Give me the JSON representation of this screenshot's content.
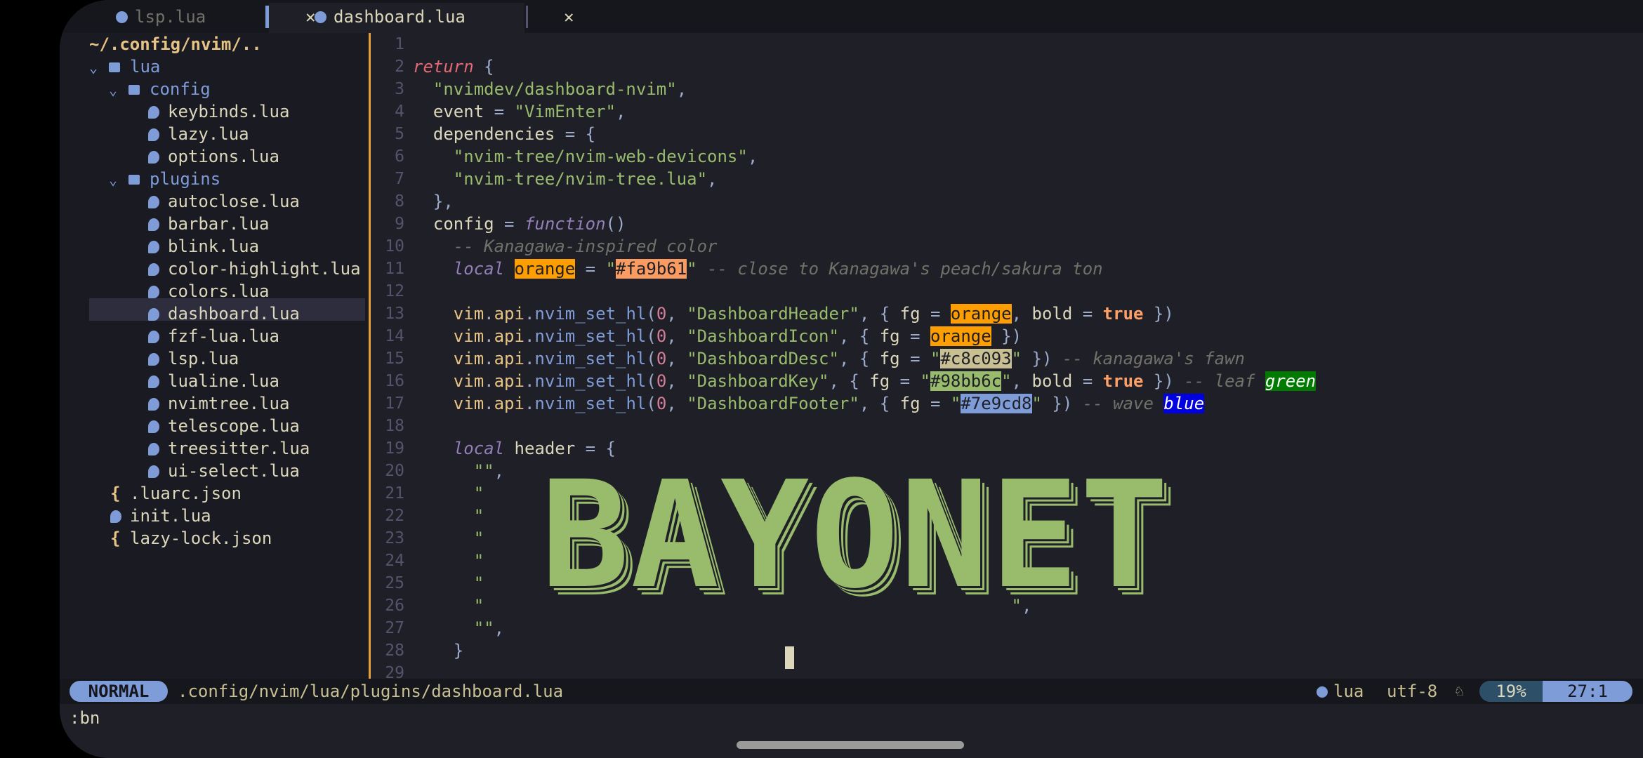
{
  "tabs": [
    {
      "label": "lsp.lua",
      "close": "✕"
    },
    {
      "label": "dashboard.lua",
      "close": "✕"
    }
  ],
  "tree": {
    "root": "~/.config/nvim/..",
    "items": [
      {
        "label": "lua",
        "type": "dir",
        "expanded": true,
        "depth": 0
      },
      {
        "label": "config",
        "type": "dir",
        "expanded": true,
        "depth": 1
      },
      {
        "label": "keybinds.lua",
        "type": "lua",
        "depth": 2
      },
      {
        "label": "lazy.lua",
        "type": "lua",
        "depth": 2
      },
      {
        "label": "options.lua",
        "type": "lua",
        "depth": 2
      },
      {
        "label": "plugins",
        "type": "dir",
        "expanded": true,
        "depth": 1
      },
      {
        "label": "autoclose.lua",
        "type": "lua",
        "depth": 2
      },
      {
        "label": "barbar.lua",
        "type": "lua",
        "depth": 2
      },
      {
        "label": "blink.lua",
        "type": "lua",
        "depth": 2
      },
      {
        "label": "color-highlight.lua",
        "type": "lua",
        "depth": 2
      },
      {
        "label": "colors.lua",
        "type": "lua",
        "depth": 2
      },
      {
        "label": "dashboard.lua",
        "type": "lua",
        "depth": 2,
        "selected": true
      },
      {
        "label": "fzf-lua.lua",
        "type": "lua",
        "depth": 2
      },
      {
        "label": "lsp.lua",
        "type": "lua",
        "depth": 2
      },
      {
        "label": "lualine.lua",
        "type": "lua",
        "depth": 2
      },
      {
        "label": "nvimtree.lua",
        "type": "lua",
        "depth": 2
      },
      {
        "label": "telescope.lua",
        "type": "lua",
        "depth": 2
      },
      {
        "label": "treesitter.lua",
        "type": "lua",
        "depth": 2
      },
      {
        "label": "ui-select.lua",
        "type": "lua",
        "depth": 2
      },
      {
        "label": ".luarc.json",
        "type": "json",
        "depth": 0
      },
      {
        "label": "init.lua",
        "type": "lua",
        "depth": 0
      },
      {
        "label": "lazy-lock.json",
        "type": "json",
        "depth": 0
      }
    ]
  },
  "editor": {
    "line_numbers": [
      "1",
      "2",
      "3",
      "4",
      "5",
      "6",
      "7",
      "8",
      "9",
      "10",
      "11",
      "12",
      "13",
      "14",
      "15",
      "16",
      "17",
      "18",
      "19",
      "20",
      "21",
      "22",
      "23",
      "24",
      "25",
      "26",
      "27",
      "28",
      "29"
    ],
    "lines": [
      [],
      [
        [
          "ret",
          "return"
        ],
        [
          "pu",
          " {"
        ]
      ],
      [
        [
          "str",
          "  \"nvimdev/dashboard-nvim\""
        ],
        [
          "pu",
          ","
        ]
      ],
      [
        [
          "fld",
          "  event "
        ],
        [
          "pu",
          "= "
        ],
        [
          "str",
          "\"VimEnter\""
        ],
        [
          "pu",
          ","
        ]
      ],
      [
        [
          "fld",
          "  dependencies "
        ],
        [
          "pu",
          "= {"
        ]
      ],
      [
        [
          "str",
          "    \"nvim-tree/nvim-web-devicons\""
        ],
        [
          "pu",
          ","
        ]
      ],
      [
        [
          "str",
          "    \"nvim-tree/nvim-tree.lua\""
        ],
        [
          "pu",
          ","
        ]
      ],
      [
        [
          "pu",
          "  },"
        ]
      ],
      [
        [
          "fld",
          "  config "
        ],
        [
          "pu",
          "= "
        ],
        [
          "kw",
          "function"
        ],
        [
          "pu",
          "()"
        ]
      ],
      [
        [
          "cm",
          "    -- Kanagawa-inspired color"
        ]
      ],
      [
        [
          "kw",
          "    local "
        ],
        [
          "hl-org",
          "orange"
        ],
        [
          "pu",
          " = "
        ],
        [
          "str",
          "\""
        ],
        [
          "hl-fa9",
          "#fa9b61"
        ],
        [
          "str",
          "\""
        ],
        [
          "cm",
          " -- close to Kanagawa's peach/sakura ton"
        ]
      ],
      [],
      [
        [
          "id",
          "    vim"
        ],
        [
          "pu",
          "."
        ],
        [
          "id",
          "api"
        ],
        [
          "pu",
          "."
        ],
        [
          "fn",
          "nvim_set_hl"
        ],
        [
          "pu",
          "("
        ],
        [
          "num",
          "0"
        ],
        [
          "pu",
          ", "
        ],
        [
          "str",
          "\"DashboardHeader\""
        ],
        [
          "pu",
          ", { "
        ],
        [
          "fld",
          "fg "
        ],
        [
          "pu",
          "= "
        ],
        [
          "hl-org",
          "orange"
        ],
        [
          "pu",
          ", "
        ],
        [
          "fld",
          "bold "
        ],
        [
          "pu",
          "= "
        ],
        [
          "bool",
          "true"
        ],
        [
          "pu",
          " })"
        ]
      ],
      [
        [
          "id",
          "    vim"
        ],
        [
          "pu",
          "."
        ],
        [
          "id",
          "api"
        ],
        [
          "pu",
          "."
        ],
        [
          "fn",
          "nvim_set_hl"
        ],
        [
          "pu",
          "("
        ],
        [
          "num",
          "0"
        ],
        [
          "pu",
          ", "
        ],
        [
          "str",
          "\"DashboardIcon\""
        ],
        [
          "pu",
          ", { "
        ],
        [
          "fld",
          "fg "
        ],
        [
          "pu",
          "= "
        ],
        [
          "hl-org",
          "orange"
        ],
        [
          "pu",
          " })"
        ]
      ],
      [
        [
          "id",
          "    vim"
        ],
        [
          "pu",
          "."
        ],
        [
          "id",
          "api"
        ],
        [
          "pu",
          "."
        ],
        [
          "fn",
          "nvim_set_hl"
        ],
        [
          "pu",
          "("
        ],
        [
          "num",
          "0"
        ],
        [
          "pu",
          ", "
        ],
        [
          "str",
          "\"DashboardDesc\""
        ],
        [
          "pu",
          ", { "
        ],
        [
          "fld",
          "fg "
        ],
        [
          "pu",
          "= "
        ],
        [
          "str",
          "\""
        ],
        [
          "hl-c8c",
          "#c8c093"
        ],
        [
          "str",
          "\""
        ],
        [
          "pu",
          " })"
        ],
        [
          "cm",
          " -- kanagawa's fawn"
        ]
      ],
      [
        [
          "id",
          "    vim"
        ],
        [
          "pu",
          "."
        ],
        [
          "id",
          "api"
        ],
        [
          "pu",
          "."
        ],
        [
          "fn",
          "nvim_set_hl"
        ],
        [
          "pu",
          "("
        ],
        [
          "num",
          "0"
        ],
        [
          "pu",
          ", "
        ],
        [
          "str",
          "\"DashboardKey\""
        ],
        [
          "pu",
          ", { "
        ],
        [
          "fld",
          "fg "
        ],
        [
          "pu",
          "= "
        ],
        [
          "str",
          "\""
        ],
        [
          "hl-98b",
          "#98bb6c"
        ],
        [
          "str",
          "\""
        ],
        [
          "pu",
          ", "
        ],
        [
          "fld",
          "bold "
        ],
        [
          "pu",
          "= "
        ],
        [
          "bool",
          "true"
        ],
        [
          "pu",
          " })"
        ],
        [
          "cm",
          " -- leaf "
        ],
        [
          "hl-grn",
          "green"
        ]
      ],
      [
        [
          "id",
          "    vim"
        ],
        [
          "pu",
          "."
        ],
        [
          "id",
          "api"
        ],
        [
          "pu",
          "."
        ],
        [
          "fn",
          "nvim_set_hl"
        ],
        [
          "pu",
          "("
        ],
        [
          "num",
          "0"
        ],
        [
          "pu",
          ", "
        ],
        [
          "str",
          "\"DashboardFooter\""
        ],
        [
          "pu",
          ", { "
        ],
        [
          "fld",
          "fg "
        ],
        [
          "pu",
          "= "
        ],
        [
          "str",
          "\""
        ],
        [
          "hl-7e9",
          "#7e9cd8"
        ],
        [
          "str",
          "\""
        ],
        [
          "pu",
          " })"
        ],
        [
          "cm",
          " -- wave "
        ],
        [
          "hl-blu",
          "blue"
        ]
      ],
      [],
      [
        [
          "kw",
          "    local "
        ],
        [
          "fld",
          "header "
        ],
        [
          "pu",
          "= {"
        ]
      ],
      [
        [
          "str",
          "      \"\""
        ],
        [
          "pu",
          ","
        ]
      ],
      [
        [
          "str",
          "      \"                                                    \""
        ],
        [
          "pu",
          ","
        ]
      ],
      [
        [
          "str",
          "      \"                                                    \""
        ],
        [
          "pu",
          ","
        ]
      ],
      [
        [
          "str",
          "      \"                                                    \""
        ],
        [
          "pu",
          ","
        ]
      ],
      [
        [
          "str",
          "      \"                                                    \""
        ],
        [
          "pu",
          ","
        ]
      ],
      [
        [
          "str",
          "      \"                                                    \""
        ],
        [
          "pu",
          ","
        ]
      ],
      [
        [
          "str",
          "      \"                                                    \""
        ],
        [
          "pu",
          ","
        ]
      ],
      [
        [
          "str",
          "      \"\""
        ],
        [
          "pu",
          ","
        ]
      ],
      [
        [
          "pu",
          "    }"
        ]
      ],
      []
    ],
    "banner": "BAYONET"
  },
  "status": {
    "mode": "NORMAL",
    "filepath": ".config/nvim/lua/plugins/dashboard.lua",
    "filetype": "lua",
    "encoding": "utf-8",
    "os_icon": "♘",
    "percent": "19%",
    "position": "27:1"
  },
  "cmdline": ":bn",
  "colors": {
    "bg": "#1f1f28",
    "accent": "#7e9cd8",
    "border": "#e6a03a",
    "string": "#98bb6c"
  }
}
